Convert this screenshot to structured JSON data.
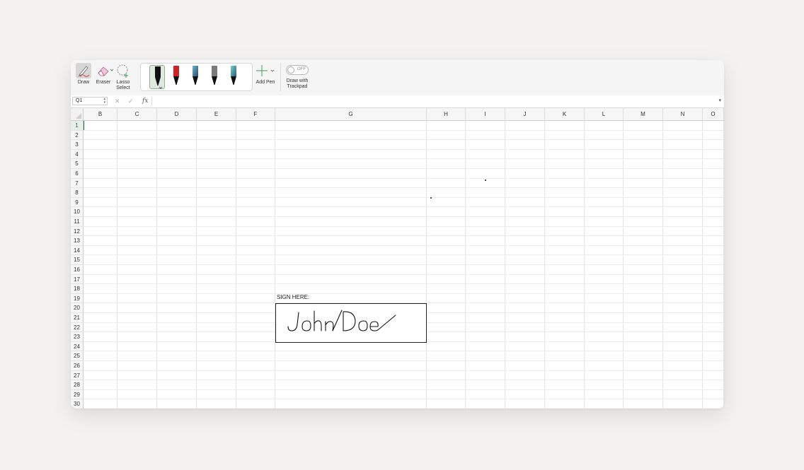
{
  "ribbon": {
    "tools": [
      {
        "name": "draw",
        "label": "Draw"
      },
      {
        "name": "eraser",
        "label": "Eraser"
      },
      {
        "name": "lasso",
        "label": "Lasso\nSelect"
      }
    ],
    "pens": [
      {
        "name": "pen-black",
        "color": "#111111",
        "selected": true
      },
      {
        "name": "pen-red",
        "color": "#d0202a"
      },
      {
        "name": "pen-galaxy-1",
        "color": "#3b6f8c"
      },
      {
        "name": "pen-gray",
        "color": "#7a7a7a"
      },
      {
        "name": "pen-galaxy-2",
        "color": "#2e8a9a"
      }
    ],
    "add_pen_label": "Add Pen",
    "toggle_state": "OFF",
    "draw_trackpad_label": "Draw with Trackpad"
  },
  "formula_bar": {
    "name_box": "Q1",
    "fx_label": "fx",
    "formula_value": ""
  },
  "sheet": {
    "columns": [
      "B",
      "C",
      "D",
      "E",
      "F",
      "G",
      "H",
      "I",
      "J",
      "K",
      "L",
      "M",
      "N",
      "O"
    ],
    "rows": [
      "1",
      "2",
      "3",
      "4",
      "5",
      "6",
      "7",
      "8",
      "9",
      "10",
      "11",
      "12",
      "13",
      "14",
      "15",
      "16",
      "17",
      "18",
      "19",
      "20",
      "21",
      "22",
      "23",
      "24",
      "25",
      "26",
      "27",
      "28",
      "29",
      "30"
    ],
    "selected_row": "1",
    "sign_label": "SIGN HERE:",
    "signature_ink_color": "#111111"
  }
}
